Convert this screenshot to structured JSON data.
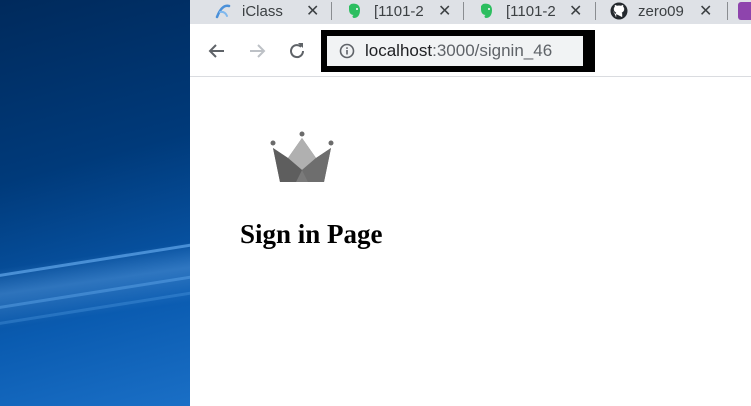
{
  "browser": {
    "tabs": [
      {
        "title": "iClass",
        "icon": "iclass-icon"
      },
      {
        "title": "[1101-2",
        "icon": "evernote-icon"
      },
      {
        "title": "[1101-2",
        "icon": "evernote-icon"
      },
      {
        "title": "zero09",
        "icon": "github-icon"
      }
    ],
    "close_glyph": "✕",
    "address": {
      "host": "localhost",
      "path": ":3000/signin_46"
    }
  },
  "page": {
    "heading": "Sign in Page",
    "logo": "crown-icon"
  },
  "colors": {
    "tabstrip": "#dee1e6",
    "toolbar": "#ffffff",
    "highlight_box": "#000000",
    "evernote_green": "#2dbe60",
    "iclass_blue": "#4a90d9",
    "crown_dark": "#6b6b6b",
    "crown_light": "#a9a9a9"
  }
}
